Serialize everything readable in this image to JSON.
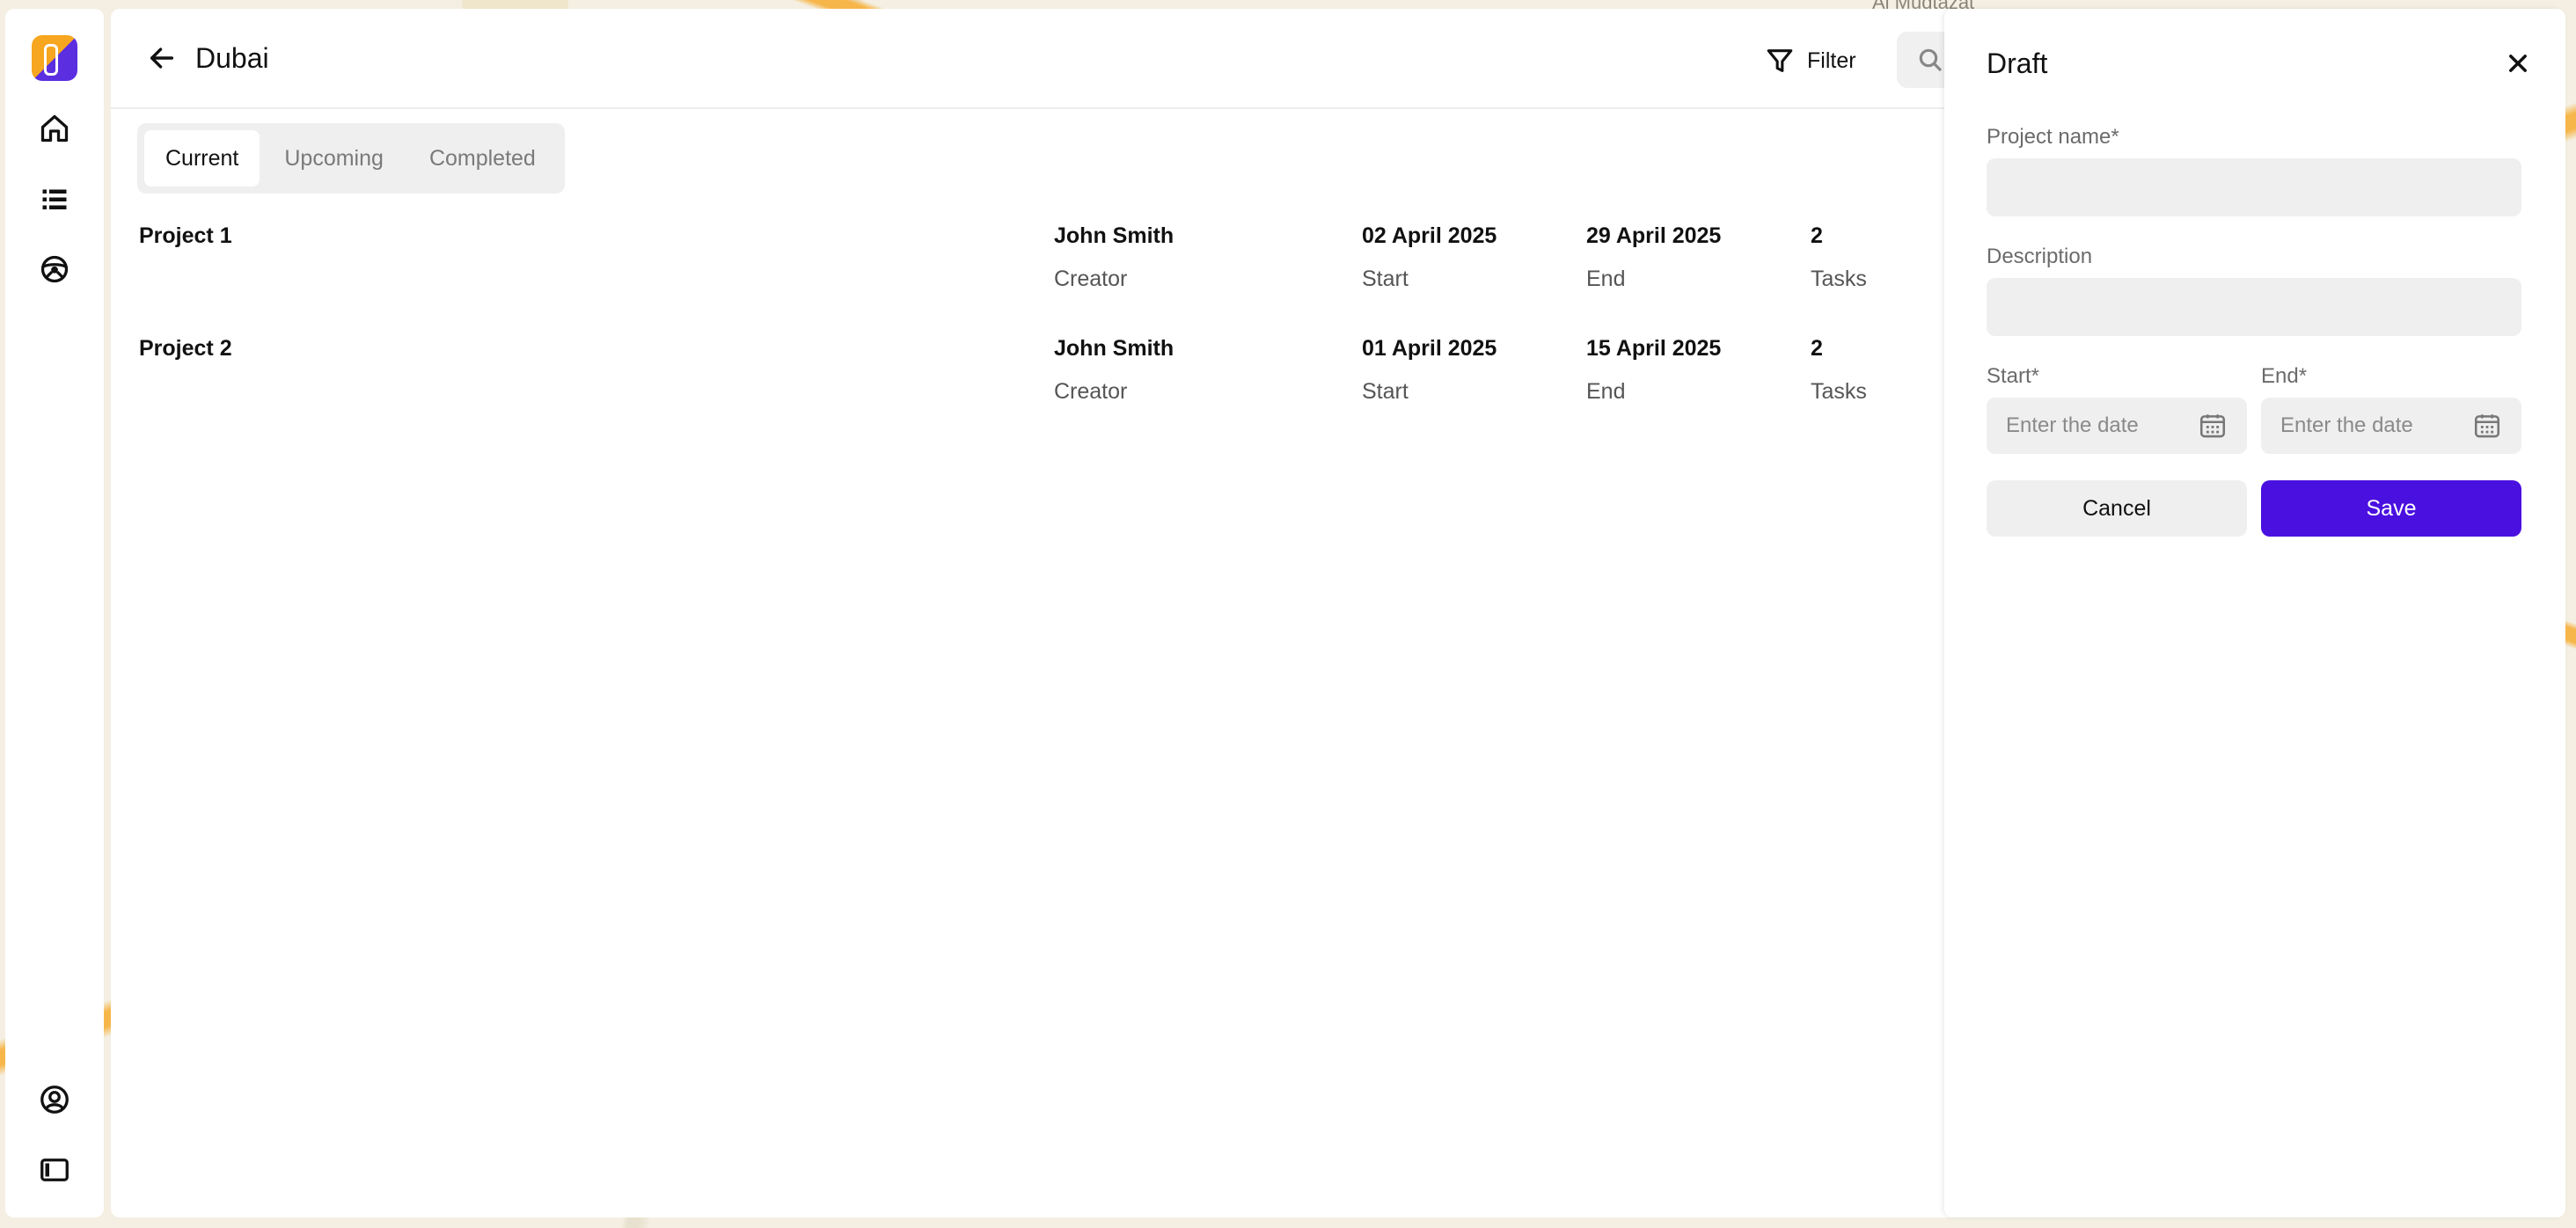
{
  "map": {
    "labels": [
      "Al Muqtazat"
    ]
  },
  "header": {
    "title": "Dubai",
    "filter_label": "Filter"
  },
  "tabs": [
    {
      "label": "Current",
      "active": true
    },
    {
      "label": "Upcoming",
      "active": false
    },
    {
      "label": "Completed",
      "active": false
    }
  ],
  "projects": [
    {
      "name": "Project 1",
      "creator": "John Smith",
      "creator_label": "Creator",
      "start": "02 April 2025",
      "start_label": "Start",
      "end": "29 April 2025",
      "end_label": "End",
      "tasks": "2",
      "tasks_label": "Tasks"
    },
    {
      "name": "Project 2",
      "creator": "John Smith",
      "creator_label": "Creator",
      "start": "01 April 2025",
      "start_label": "Start",
      "end": "15 April 2025",
      "end_label": "End",
      "tasks": "2",
      "tasks_label": "Tasks"
    }
  ],
  "drawer": {
    "title": "Draft",
    "project_name_label": "Project name*",
    "project_name_value": "",
    "description_label": "Description",
    "description_value": "",
    "start_label": "Start*",
    "start_placeholder": "Enter the date",
    "end_label": "End*",
    "end_placeholder": "Enter the date",
    "cancel_label": "Cancel",
    "save_label": "Save"
  },
  "colors": {
    "accent": "#4a10e0",
    "input_bg": "#efefef",
    "map_road": "#f6b64a"
  }
}
